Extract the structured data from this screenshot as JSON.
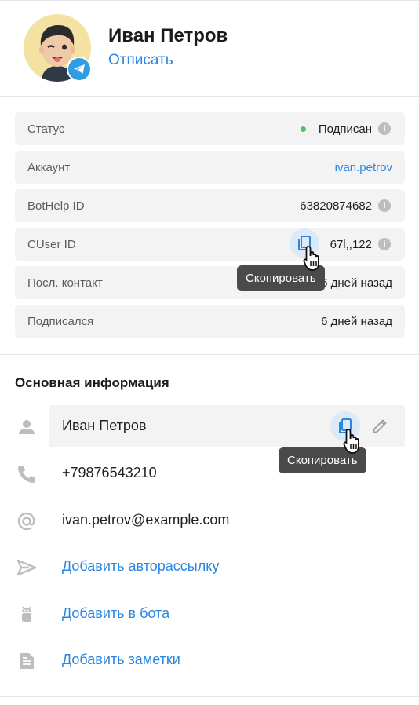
{
  "profile": {
    "name": "Иван Петров",
    "unsubscribe_label": "Отписать"
  },
  "details": [
    {
      "label": "Статус",
      "value": "Подписан"
    },
    {
      "label": "Аккаунт",
      "value": "ivan.petrov"
    },
    {
      "label": "BotHelp ID",
      "value": "63820874682"
    },
    {
      "label": "CUser ID",
      "value": "67l,,122"
    },
    {
      "label": "Посл. контакт",
      "value": "6 дней назад"
    },
    {
      "label": "Подписался",
      "value": "6 дней назад"
    }
  ],
  "tooltip_copy": "Скопировать",
  "main_info": {
    "title": "Основная информация",
    "name": "Иван Петров",
    "phone": "+79876543210",
    "email": "ivan.petrov@example.com",
    "add_autocampaign": "Добавить авторассылку",
    "add_to_bot": "Добавить в бота",
    "add_notes": "Добавить заметки"
  },
  "icons": {
    "badge": "telegram-icon",
    "status_dot_color": "#4cc364",
    "accent": "#2a86e0"
  }
}
